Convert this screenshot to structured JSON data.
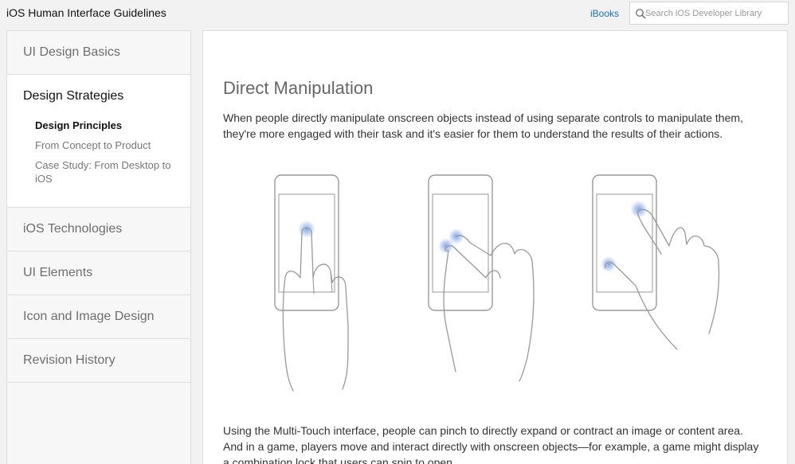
{
  "header": {
    "title": "iOS Human Interface Guidelines",
    "ibooks_label": "iBooks",
    "search_placeholder": "Search iOS Developer Library"
  },
  "sidebar": {
    "items": [
      {
        "label": "UI Design Basics"
      },
      {
        "label": "Design Strategies",
        "expanded": true,
        "children": [
          {
            "label": "Design Principles",
            "active": true
          },
          {
            "label": "From Concept to Product"
          },
          {
            "label": "Case Study: From Desktop to iOS"
          }
        ]
      },
      {
        "label": "iOS Technologies"
      },
      {
        "label": "UI Elements"
      },
      {
        "label": "Icon and Image Design"
      },
      {
        "label": "Revision History"
      }
    ]
  },
  "article": {
    "title": "Direct Manipulation",
    "intro": "When people directly manipulate onscreen objects instead of using separate controls to manipulate them, they're more engaged with their task and it's easier for them to understand the results of their actions.",
    "body": "Using the Multi-Touch interface, people can pinch to directly expand or contract an image or content area. And in a game, players move and interact directly with onscreen objects—for example, a game might display a combination lock that users can spin to open."
  },
  "colors": {
    "link": "#1a6fb8",
    "touch_glow": "#7fa6e6"
  }
}
